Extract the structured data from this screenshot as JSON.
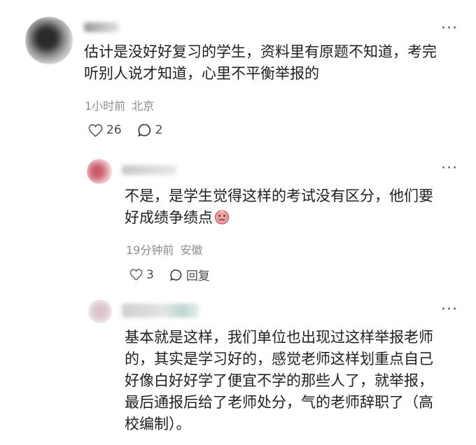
{
  "comments": [
    {
      "text_lines": [
        "估计是没好好复习的学生，资料里有原题不知道，考完",
        "听别人说才知道，心里不平衡举报的"
      ],
      "time": "1小时前",
      "location": "北京",
      "likes": "26",
      "replies": "2",
      "icons": {
        "like": "heart-icon",
        "comment": "comment-icon",
        "more": "more-icon"
      }
    },
    {
      "text_lines": [
        "不是，是学生觉得这样的考试没有区分，他们要",
        "好成绩争绩点"
      ],
      "emoji": "crying-face-emoji",
      "time": "19分钟前",
      "location": "安徽",
      "likes": "3",
      "reply_label": "回复",
      "icons": {
        "like": "heart-icon",
        "comment": "comment-icon",
        "more": "more-icon"
      }
    },
    {
      "text_lines": [
        "基本就是这样，我们单位也出现过这样举报老师",
        "的，其实是学习好的，感觉老师这样划重点自己",
        "好像白好好学了便宜不学的那些人了，就举报，",
        "最后通报后给了老师处分，气的老师辞职了（高",
        "校编制）。"
      ],
      "icons": {
        "more": "more-icon"
      }
    }
  ],
  "more_glyph": "···"
}
